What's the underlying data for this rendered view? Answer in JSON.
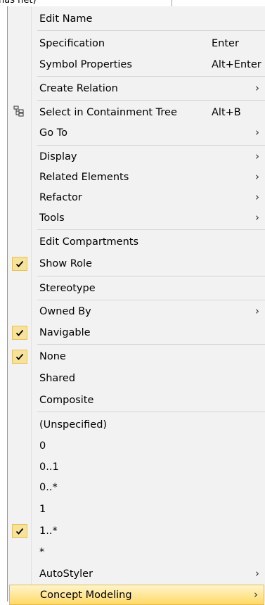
{
  "top_strip": {
    "crumb": "has net)"
  },
  "menu": {
    "items": [
      {
        "label": "Edit Name"
      },
      {
        "label": "Specification",
        "shortcut": "Enter"
      },
      {
        "label": "Symbol Properties",
        "shortcut": "Alt+Enter"
      },
      {
        "label": "Create Relation",
        "submenu": "›"
      },
      {
        "label": "Select in Containment Tree",
        "shortcut": "Alt+B",
        "icon": "containment-tree-icon"
      },
      {
        "label": "Go To",
        "submenu": "›"
      },
      {
        "label": "Display",
        "submenu": "›"
      },
      {
        "label": "Related Elements",
        "submenu": "›"
      },
      {
        "label": "Refactor",
        "submenu": "›"
      },
      {
        "label": "Tools",
        "submenu": "›"
      },
      {
        "label": "Edit Compartments"
      },
      {
        "label": "Show Role",
        "checked": true
      },
      {
        "label": "Stereotype"
      },
      {
        "label": "Owned By",
        "submenu": "›"
      },
      {
        "label": "Navigable",
        "checked": true
      },
      {
        "label": "None",
        "checked": true
      },
      {
        "label": "Shared"
      },
      {
        "label": "Composite"
      },
      {
        "label": "(Unspecified)"
      },
      {
        "label": "0"
      },
      {
        "label": "0..1"
      },
      {
        "label": "0..*"
      },
      {
        "label": "1"
      },
      {
        "label": "1..*",
        "checked": true
      },
      {
        "label": "*"
      },
      {
        "label": "AutoStyler",
        "submenu": "›"
      },
      {
        "label": "Concept Modeling",
        "submenu": "›",
        "highlighted": true
      }
    ]
  },
  "colors": {
    "menu_bg": "#f2f2f2",
    "check_bg": "#f6e29a",
    "highlight": "#ffd966"
  }
}
